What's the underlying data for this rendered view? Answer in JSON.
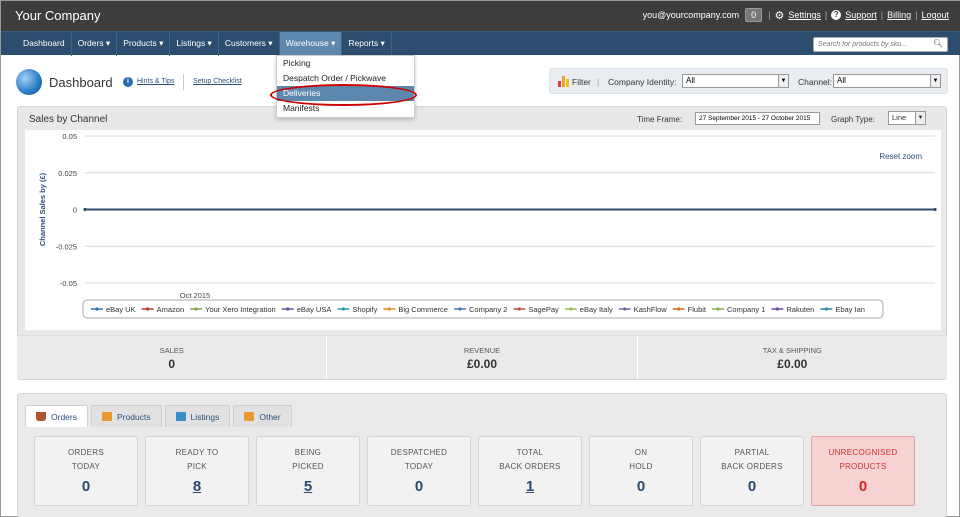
{
  "topbar": {
    "brand": "Your Company",
    "email": "you@yourcompany.com",
    "notification_count": "0",
    "settings": "Settings",
    "support": "Support",
    "billing": "Billing",
    "logout": "Logout",
    "separator": "|"
  },
  "nav": {
    "items": [
      {
        "label": "Dashboard",
        "icon": ""
      },
      {
        "label": "Orders ▾"
      },
      {
        "label": "Products ▾"
      },
      {
        "label": "Listings ▾"
      },
      {
        "label": "Customers ▾"
      },
      {
        "label": "Warehouse ▾"
      },
      {
        "label": "Reports ▾"
      }
    ],
    "search_placeholder": "Search for products by sku..."
  },
  "warehouse_menu": {
    "items": [
      "Picking",
      "Despatch Order / Pickwave",
      "Deliveries",
      "Manifests"
    ],
    "selected": "Deliveries"
  },
  "header": {
    "title": "Dashboard",
    "hints": "Hints & Tips",
    "setup": "Setup Checklist"
  },
  "filter": {
    "label": "Filter",
    "company_identity_label": "Company Identity:",
    "company_identity_value": "All",
    "channel_label": "Channel:",
    "channel_value": "All",
    "separator": "|"
  },
  "sales_panel": {
    "title": "Sales by Channel",
    "time_frame_label": "Time Frame:",
    "time_frame_value": "27 September 2015 - 27 October 2015",
    "graph_type_label": "Graph Type:",
    "graph_type_value": "Line",
    "reset_zoom": "Reset zoom"
  },
  "chart_data": {
    "type": "line",
    "ylabel": "Channel Sales by (£)",
    "xlabel": "",
    "y_ticks": [
      "0.05",
      "0.025",
      "0",
      "-0.025",
      "-0.05"
    ],
    "x_tick": "Oct 2015",
    "ylim": [
      -0.05,
      0.05
    ],
    "legend": [
      "eBay UK",
      "Amazon",
      "Your Xero Integration",
      "eBay USA",
      "Shopify",
      "Big Commerce",
      "Company 2",
      "SagePay",
      "eBay Italy",
      "KashFlow",
      "Flubit",
      "Company 1",
      "Rakuten",
      "Ebay Ian"
    ],
    "legend_colors": [
      "#2f6fb0",
      "#c0392b",
      "#7fa34a",
      "#6e4fa0",
      "#2b9aa8",
      "#e08b2a",
      "#4a79b5",
      "#c0504d",
      "#9bbb59",
      "#8064a2",
      "#d2691e",
      "#8ab04a",
      "#6b4c9a",
      "#2a8aa0"
    ],
    "series_values": [
      0,
      0
    ]
  },
  "summary": {
    "sales_label": "SALES",
    "sales_value": "0",
    "revenue_label": "REVENUE",
    "revenue_value": "£0.00",
    "tax_label": "TAX & SHIPPING",
    "tax_value": "£0.00"
  },
  "tabs": [
    {
      "label": "Orders",
      "icon": "basket-icon",
      "color": "#b0522a"
    },
    {
      "label": "Products",
      "icon": "chart-bar-icon",
      "color": "#e89a30"
    },
    {
      "label": "Listings",
      "icon": "monitor-icon",
      "color": "#3b8cc9"
    },
    {
      "label": "Other",
      "icon": "bar-chart-icon",
      "color": "#e89a30"
    }
  ],
  "cards": [
    {
      "l1": "ORDERS",
      "l2": "TODAY",
      "v": "0",
      "link": false,
      "alert": false
    },
    {
      "l1": "READY TO",
      "l2": "PICK",
      "v": "8",
      "link": true,
      "alert": false
    },
    {
      "l1": "BEING",
      "l2": "PICKED",
      "v": "5",
      "link": true,
      "alert": false
    },
    {
      "l1": "DESPATCHED",
      "l2": "TODAY",
      "v": "0",
      "link": false,
      "alert": false
    },
    {
      "l1": "TOTAL",
      "l2": "BACK ORDERS",
      "v": "1",
      "link": true,
      "alert": false
    },
    {
      "l1": "ON",
      "l2": "HOLD",
      "v": "0",
      "link": false,
      "alert": false
    },
    {
      "l1": "PARTIAL",
      "l2": "BACK ORDERS",
      "v": "0",
      "link": false,
      "alert": false
    },
    {
      "l1": "UNRECOGNISED",
      "l2": "PRODUCTS",
      "v": "0",
      "link": false,
      "alert": true
    }
  ],
  "colors": {
    "topbar": "#3d3d3d",
    "navbar": "#2c4d6e",
    "accent": "#5e87ad",
    "link": "#2a4f7a",
    "alert": "#d22"
  }
}
